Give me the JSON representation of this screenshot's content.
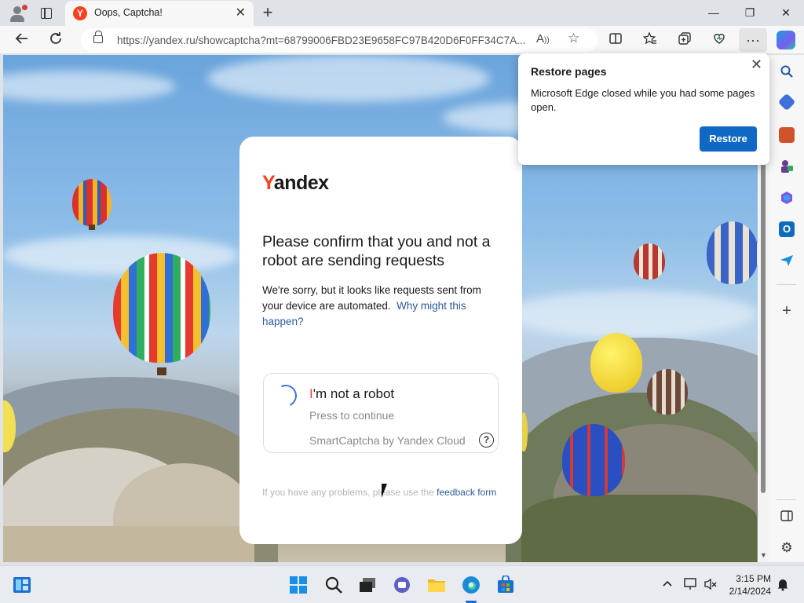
{
  "browser": {
    "tab_title": "Oops, Captcha!",
    "tab_favicon_letter": "Y",
    "url": "https://yandex.ru/showcaptcha?mt=68799006FBD23E9658FC97B420D6F0FF34C7A...",
    "new_tab_symbol": "+",
    "window_controls": {
      "minimize": "—",
      "restore": "❐",
      "close": "✕"
    }
  },
  "captcha": {
    "logo_first": "Y",
    "logo_rest": "andex",
    "heading": "Please confirm that you and not a robot are sending requests",
    "description": "We're sorry, but it looks like requests sent from your device are automated.",
    "why_link": "Why might this happen?",
    "checkbox_first": "I",
    "checkbox_rest": "'m not a robot",
    "press_text": "Press to continue",
    "provider_text": "SmartCaptcha by Yandex Cloud",
    "help_symbol": "?",
    "footer_prefix": "If you have any problems, please use the",
    "footer_link": "feedback form"
  },
  "popup": {
    "title": "Restore pages",
    "message": "Microsoft Edge closed while you had some pages open.",
    "button": "Restore"
  },
  "taskbar": {
    "time": "3:15 PM",
    "date": "2/14/2024"
  },
  "colors": {
    "yandex_red": "#fc3f1d",
    "link_blue": "#2e5a9c",
    "restore_blue": "#1068c5"
  }
}
